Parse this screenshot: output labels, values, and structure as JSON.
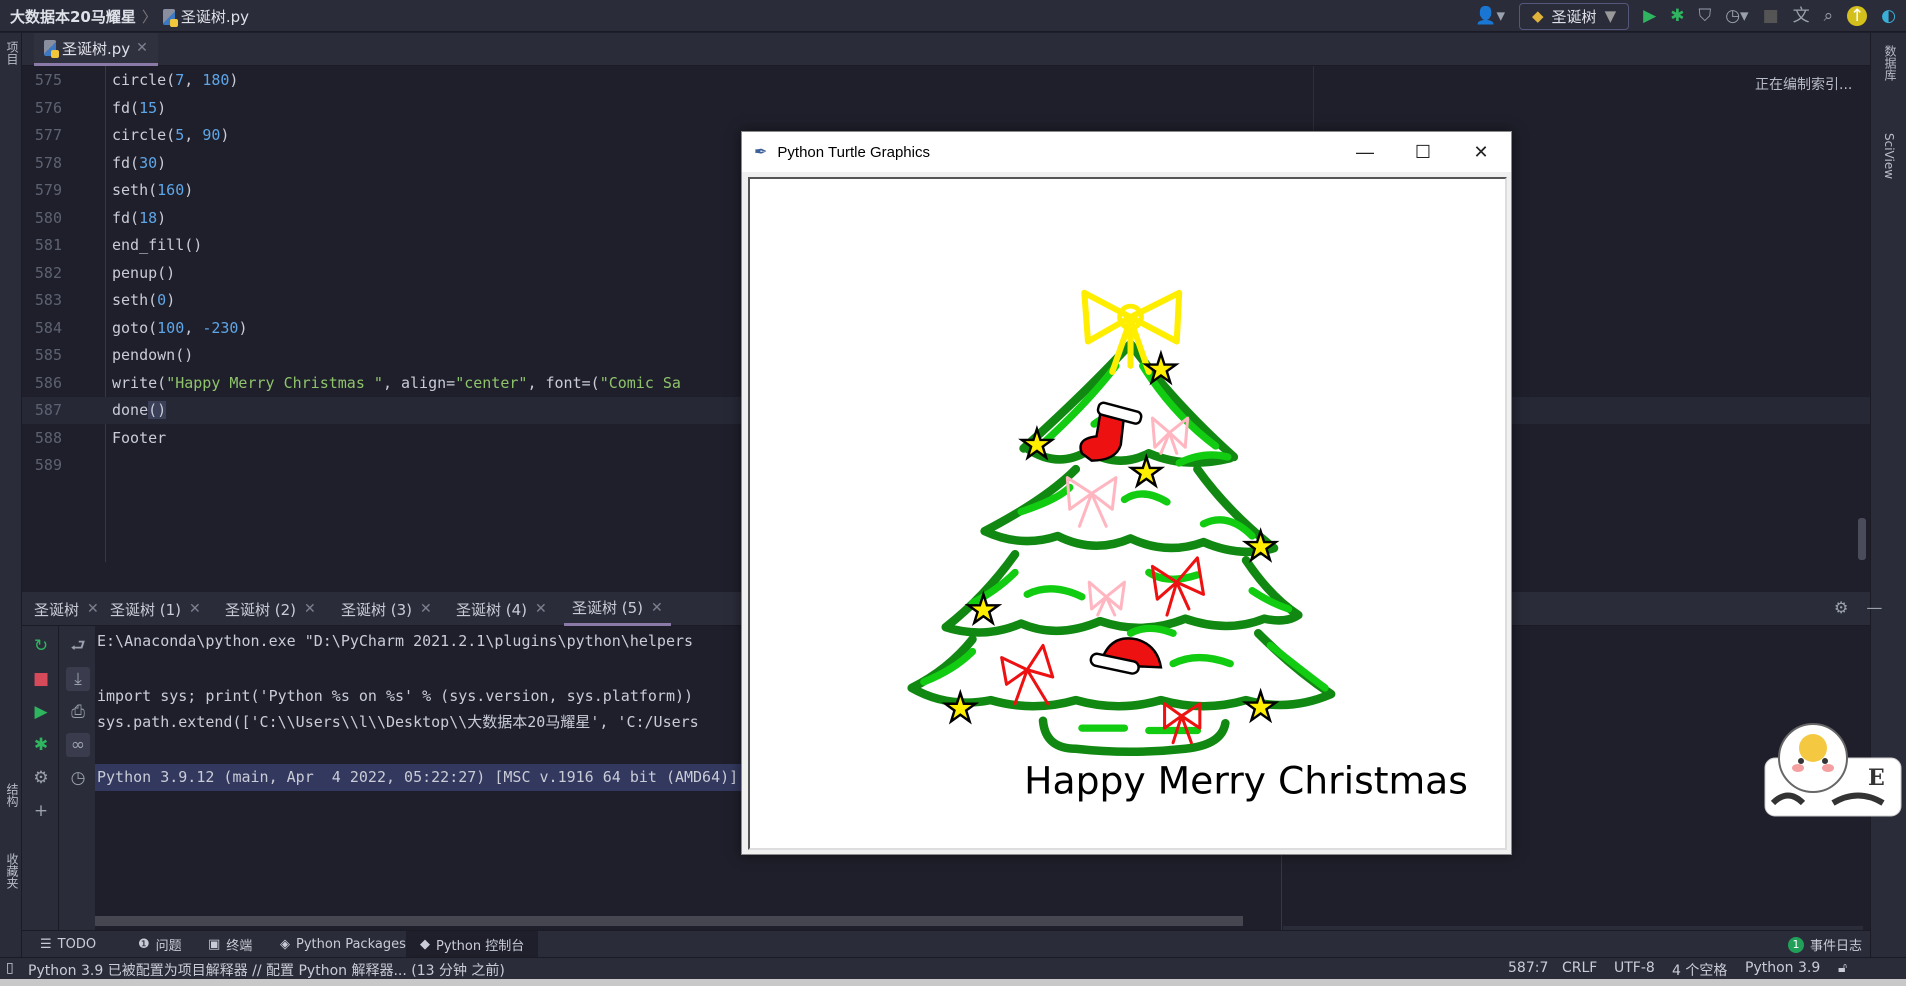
{
  "titlebar": {
    "project": "大数据本20马耀星",
    "file": "圣诞树.py"
  },
  "toolbar": {
    "run_config": "圣诞树"
  },
  "left_strip": {
    "project_label": "项目",
    "structure_label": "结构",
    "favorites_label": "收藏夹"
  },
  "right_strip": {
    "database_label": "数据库",
    "sciview_label": "SciView"
  },
  "editor": {
    "tab": "圣诞树.py",
    "indexing": "正在编制索引...",
    "current_line": 587,
    "lines": [
      {
        "n": "575",
        "seg": [
          [
            "circle(",
            "def"
          ],
          [
            "7",
            "num"
          ],
          [
            ", ",
            "def"
          ],
          [
            "180",
            "num"
          ],
          [
            ")",
            "def"
          ]
        ]
      },
      {
        "n": "576",
        "seg": [
          [
            "fd(",
            "def"
          ],
          [
            "15",
            "num"
          ],
          [
            ")",
            "def"
          ]
        ]
      },
      {
        "n": "577",
        "seg": [
          [
            "circle(",
            "def"
          ],
          [
            "5",
            "num"
          ],
          [
            ", ",
            "def"
          ],
          [
            "90",
            "num"
          ],
          [
            ")",
            "def"
          ]
        ]
      },
      {
        "n": "578",
        "seg": [
          [
            "fd(",
            "def"
          ],
          [
            "30",
            "num"
          ],
          [
            ")",
            "def"
          ]
        ]
      },
      {
        "n": "579",
        "seg": [
          [
            "seth(",
            "def"
          ],
          [
            "160",
            "num"
          ],
          [
            ")",
            "def"
          ]
        ]
      },
      {
        "n": "580",
        "seg": [
          [
            "fd(",
            "def"
          ],
          [
            "18",
            "num"
          ],
          [
            ")",
            "def"
          ]
        ]
      },
      {
        "n": "581",
        "seg": [
          [
            "end_fill()",
            "def"
          ]
        ]
      },
      {
        "n": "582",
        "seg": [
          [
            "penup()",
            "def"
          ]
        ]
      },
      {
        "n": "583",
        "seg": [
          [
            "seth(",
            "def"
          ],
          [
            "0",
            "num"
          ],
          [
            ")",
            "def"
          ]
        ]
      },
      {
        "n": "584",
        "seg": [
          [
            "goto(",
            "def"
          ],
          [
            "100",
            "num"
          ],
          [
            ", ",
            "def"
          ],
          [
            "-230",
            "num"
          ],
          [
            ")",
            "def"
          ]
        ]
      },
      {
        "n": "585",
        "seg": [
          [
            "pendown()",
            "def"
          ]
        ]
      },
      {
        "n": "586",
        "seg": [
          [
            "write(",
            "def"
          ],
          [
            "\"Happy Merry Christmas \"",
            "str"
          ],
          [
            ", align=",
            "def"
          ],
          [
            "\"center\"",
            "str"
          ],
          [
            ", font=(",
            "def"
          ],
          [
            "\"Comic Sa",
            "str"
          ]
        ]
      },
      {
        "n": "587",
        "seg": [
          [
            "done",
            "def"
          ],
          [
            "()",
            "br"
          ]
        ]
      },
      {
        "n": "588",
        "seg": [
          [
            "Footer",
            "def"
          ]
        ]
      },
      {
        "n": "589",
        "seg": []
      }
    ]
  },
  "run": {
    "tabs": [
      "圣诞树",
      "圣诞树 (1)",
      "圣诞树 (2)",
      "圣诞树 (3)",
      "圣诞树 (4)",
      "圣诞树 (5)"
    ],
    "active_tab": 5,
    "console": [
      "E:\\Anaconda\\python.exe \"D:\\PyCharm 2021.2.1\\plugins\\python\\helpers",
      "",
      "import sys; print('Python %s on %s' % (sys.version, sys.platform))",
      "sys.path.extend(['C:\\\\Users\\\\l\\\\Desktop\\\\大数据本20马耀星', 'C:/Users",
      "",
      "Python 3.9.12 (main, Apr  4 2022, 05:22:27) [MSC v.1916 64 bit (AMD64)]"
    ]
  },
  "bottom_tabs": [
    "TODO",
    "问题",
    "终端",
    "Python Packages",
    "Python 控制台"
  ],
  "event_log": {
    "count": "1",
    "label": "事件日志"
  },
  "status": {
    "message": "Python 3.9 已被配置为项目解释器 // 配置 Python 解释器... (13 分钟 之前)",
    "position": "587:7",
    "line_sep": "CRLF",
    "encoding": "UTF-8",
    "indent": "4 个空格",
    "interpreter": "Python 3.9"
  },
  "turtle_window": {
    "title": "Python Turtle Graphics",
    "greeting": "Happy Merry Christmas"
  },
  "colors": {
    "tree_dark": "#118811",
    "tree_light": "#11cc11",
    "star": "#ffee00",
    "bow_top": "#ffee00",
    "red": "#ee1111",
    "pink": "#ffb6c1"
  }
}
